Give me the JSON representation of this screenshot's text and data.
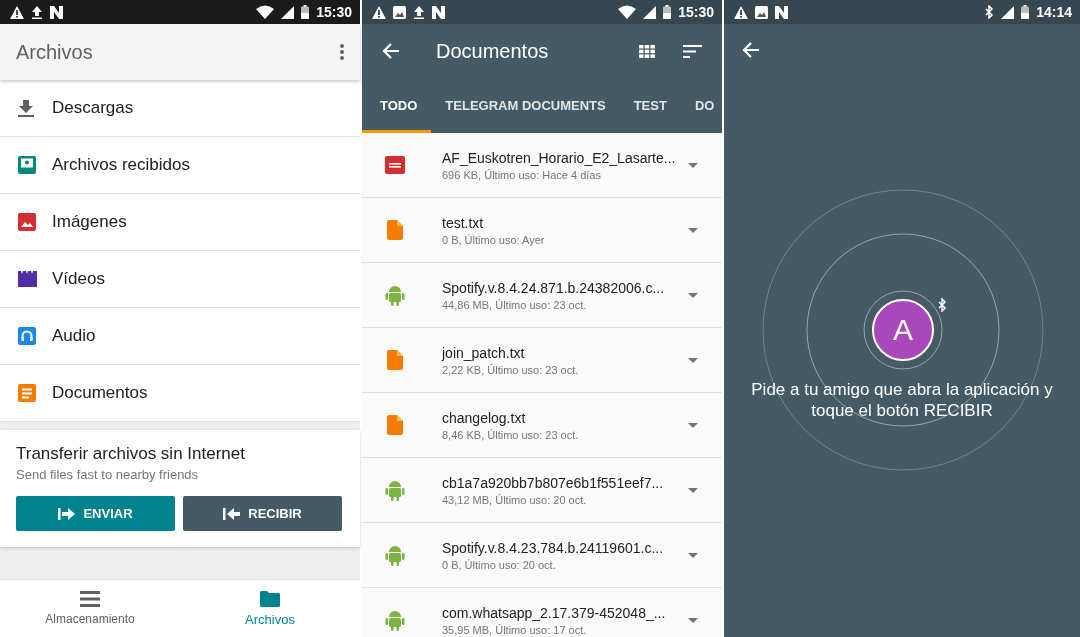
{
  "files_screen": {
    "status_bar": {
      "time": "15:30"
    },
    "title": "Archivos",
    "categories": [
      {
        "label": "Descargas",
        "kind": "download"
      },
      {
        "label": "Archivos recibidos",
        "kind": "received"
      },
      {
        "label": "Imágenes",
        "kind": "images"
      },
      {
        "label": "Vídeos",
        "kind": "videos"
      },
      {
        "label": "Audio",
        "kind": "audio"
      },
      {
        "label": "Documentos",
        "kind": "documents"
      }
    ],
    "transfer_card": {
      "title": "Transferir archivos sin Internet",
      "subtitle": "Send files fast to nearby friends",
      "buttons": [
        {
          "label": "ENVIAR",
          "kind": "send"
        },
        {
          "label": "RECIBIR",
          "kind": "receive"
        }
      ]
    },
    "bottom_nav": [
      {
        "label": "Almacenamiento",
        "kind": "storage",
        "selected": false
      },
      {
        "label": "Archivos",
        "kind": "files",
        "selected": true
      }
    ]
  },
  "documents_screen": {
    "status_bar": {
      "time": "15:30"
    },
    "title": "Documentos",
    "tabs": [
      {
        "label": "TODO",
        "selected": true
      },
      {
        "label": "TELEGRAM DOCUMENTS",
        "selected": false
      },
      {
        "label": "TEST",
        "selected": false
      },
      {
        "label": "DO",
        "selected": false
      }
    ],
    "files": [
      {
        "name": "AF_Euskotren_Horario_E2_Lasarte...",
        "details": "696 KB, Último uso: Hace 4 días",
        "kind": "pdf"
      },
      {
        "name": "test.txt",
        "details": "0 B, Último uso: Ayer",
        "kind": "text"
      },
      {
        "name": "Spotify.v.8.4.24.871.b.24382006.c...",
        "details": "44,86 MB, Último uso: 23 oct.",
        "kind": "apk"
      },
      {
        "name": "join_patch.txt",
        "details": "2,22 KB, Último uso: 23 oct.",
        "kind": "text"
      },
      {
        "name": "changelog.txt",
        "details": "8,46 KB, Último uso: 23 oct.",
        "kind": "text"
      },
      {
        "name": "cb1a7a920bb7b807e6b1f551eef7...",
        "details": "43,12 MB, Último uso: 20 oct.",
        "kind": "apk"
      },
      {
        "name": "Spotify.v.8.4.23.784.b.24119601.c...",
        "details": "0 B, Último uso: 20 oct.",
        "kind": "apk"
      },
      {
        "name": "com.whatsapp_2.17.379-452048_...",
        "details": "35,95 MB, Último uso: 17 oct.",
        "kind": "apk"
      }
    ]
  },
  "receive_screen": {
    "status_bar": {
      "time": "14:14"
    },
    "avatar": "A",
    "message": "Pide a tu amigo que abra la aplicación y toque el botón RECIBIR"
  }
}
